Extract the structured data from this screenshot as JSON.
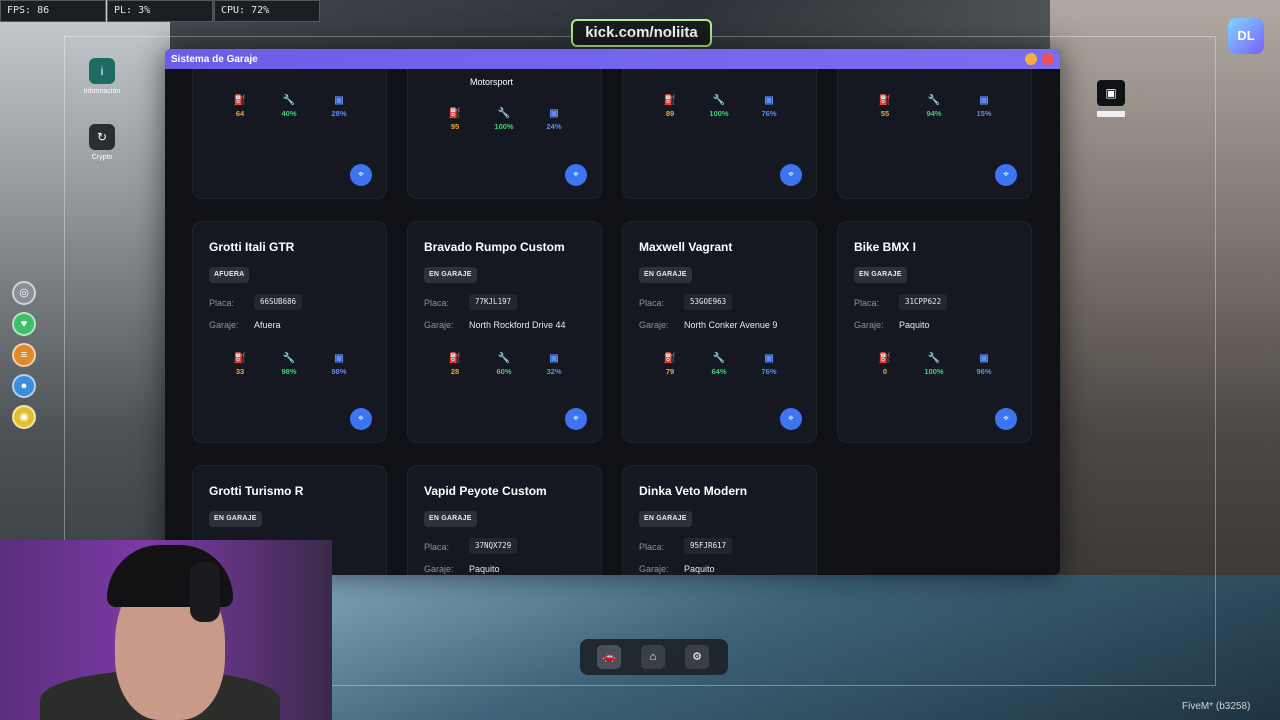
{
  "hud": {
    "fps": "FPS: 86",
    "pl": "PL: 3%",
    "cpu": "CPU: 72%"
  },
  "stream_badge": "kick.com/noliita",
  "footer_build": "FiveM* (b3258)",
  "phone_apps": [
    {
      "label": "Información"
    },
    {
      "label": "Crypto"
    }
  ],
  "window": {
    "title": "Sistema de Garaje",
    "labels": {
      "plate": "Placa:",
      "garage": "Garaje:"
    },
    "cards": [
      {
        "name": "",
        "extra_text": "",
        "fuel": "64",
        "engine": "40%",
        "body": "28%"
      },
      {
        "name": "",
        "extra_text": "Motorsport",
        "fuel": "95",
        "engine": "100%",
        "body": "24%"
      },
      {
        "name": "",
        "extra_text": "",
        "fuel": "89",
        "engine": "100%",
        "body": "76%"
      },
      {
        "name": "",
        "extra_text": "",
        "fuel": "55",
        "engine": "94%",
        "body": "15%"
      },
      {
        "name": "Grotti Itali GTR",
        "status": "AFUERA",
        "plate": "66SUB686",
        "garage": "Afuera",
        "fuel": "33",
        "engine": "98%",
        "body": "98%"
      },
      {
        "name": "Bravado Rumpo Custom",
        "status": "EN GARAJE",
        "plate": "77KJL197",
        "garage": "North Rockford Drive 44",
        "fuel": "28",
        "engine": "60%",
        "body": "32%"
      },
      {
        "name": "Maxwell Vagrant",
        "status": "EN GARAJE",
        "plate": "53GOE963",
        "garage": "North Conker Avenue 9",
        "fuel": "79",
        "engine": "64%",
        "body": "76%"
      },
      {
        "name": "Bike BMX I",
        "status": "EN GARAJE",
        "plate": "31CPP622",
        "garage": "Paquito",
        "fuel": "0",
        "engine": "100%",
        "body": "96%"
      },
      {
        "name": "Grotti Turismo R",
        "status": "EN GARAJE"
      },
      {
        "name": "Vapid Peyote Custom",
        "status": "EN GARAJE",
        "plate": "37NQX729",
        "garage": "Paquito"
      },
      {
        "name": "Dinka Veto Modern",
        "status": "EN GARAJE",
        "plate": "95FJR617",
        "garage": "Paquito"
      }
    ]
  },
  "icons": {
    "fuel": "fuel-pump-icon",
    "engine": "wrench-icon",
    "body": "car-body-icon",
    "locate": "map-pin-icon"
  },
  "colors": {
    "title_bar": "#6a5ee8",
    "fuel": "#f0a43a",
    "engine": "#3fd17a",
    "body": "#5b8cf7",
    "locate_button": "#3d74f0"
  },
  "bottom_nav": [
    "car-icon",
    "garage-icon",
    "settings-icon"
  ]
}
